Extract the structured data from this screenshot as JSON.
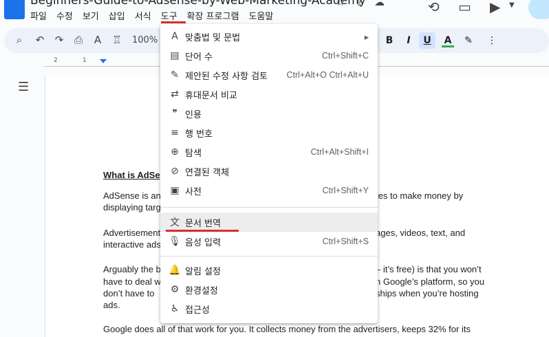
{
  "title": "Beginners-Guide-to-Adsense-by-Web-Marketing-Academy",
  "menu": [
    "파일",
    "수정",
    "보기",
    "삽입",
    "서식",
    "도구",
    "확장 프로그램",
    "도움말"
  ],
  "toolbar": {
    "zoom": "100%"
  },
  "ruler": {
    "left_num": "2",
    "right_num": "1"
  },
  "tools_menu": {
    "items": [
      {
        "icon": "A",
        "label": "맞춤법 및 문법",
        "shortcut": "▸"
      },
      {
        "icon": "▤",
        "label": "단어 수",
        "shortcut": "Ctrl+Shift+C"
      },
      {
        "icon": "✎",
        "label": "제안된 수정 사항 검토",
        "shortcut": "Ctrl+Alt+O Ctrl+Alt+U"
      },
      {
        "icon": "⇄",
        "label": "휴대문서 비교",
        "shortcut": ""
      },
      {
        "icon": "❞",
        "label": "인용",
        "shortcut": ""
      },
      {
        "icon": "≡",
        "label": "행 번호",
        "shortcut": ""
      },
      {
        "icon": "⊕",
        "label": "탐색",
        "shortcut": "Ctrl+Alt+Shift+I"
      },
      {
        "icon": "⊘",
        "label": "연결된 객체",
        "shortcut": ""
      },
      {
        "icon": "▣",
        "label": "사전",
        "shortcut": "Ctrl+Shift+Y"
      },
      {
        "icon": "文",
        "label": "문서 번역",
        "shortcut": ""
      },
      {
        "icon": "🎙",
        "label": "음성 입력",
        "shortcut": "Ctrl+Shift+S"
      },
      {
        "icon": "🔔",
        "label": "알림 설정",
        "shortcut": ""
      },
      {
        "icon": "⚙",
        "label": "환경설정",
        "shortcut": ""
      },
      {
        "icon": "♿",
        "label": "접근성",
        "shortcut": ""
      }
    ]
  },
  "doc": {
    "heading": "What is AdSe",
    "p1a": "AdSense is an",
    "p1a_right": "tes to make money by",
    "p1b": "displaying targ",
    "p2a": "Advertisement",
    "p2a_right": "ages, videos, text, and",
    "p2b": "interactive ads",
    "p3a": "Arguably the b",
    "p3a_right": "– it’s free) is that you won’t",
    "p3b": "have to deal w",
    "p3b_right": "n Google’s platform, so you",
    "p3c": "don’t have to",
    "p3c_right": "ships when you’re hosting",
    "p3d": "ads.",
    "p4": "Google does all of that work for you. It collects money from the advertisers, keeps 32% for its"
  }
}
